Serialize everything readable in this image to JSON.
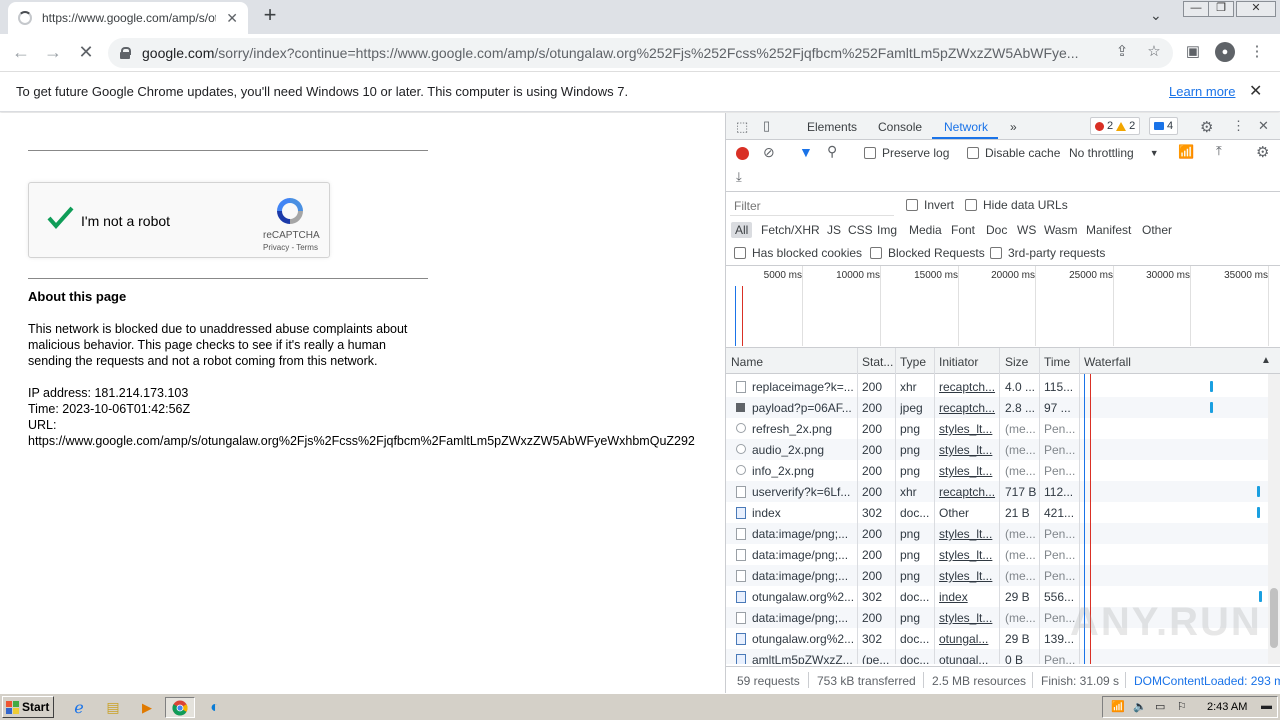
{
  "browser": {
    "tab_title": "https://www.google.com/amp/s/otungalaw.org",
    "tab_close": "✕",
    "new_tab": "+",
    "url_host": "google.com",
    "url_rest": "/sorry/index?continue=https://www.google.com/amp/s/otungalaw.org%252Fjs%252Fcss%252Fjqfbcm%252FamltLm5pZWxzZW5AbWFye...",
    "window_buttons": [
      "—",
      "❐",
      "✕"
    ]
  },
  "infobar": {
    "message": "To get future Google Chrome updates, you'll need Windows 10 or later. This computer is using Windows 7.",
    "learn_more": "Learn more",
    "close": "✕"
  },
  "page": {
    "captcha_label": "I'm not a robot",
    "captcha_brand": "reCAPTCHA",
    "captcha_links": "Privacy - Terms",
    "about_title": "About this page",
    "paragraph_lines": [
      "This network is blocked due to unaddressed abuse complaints about",
      "malicious behavior. This page checks to see if it's really a human",
      "sending the requests and not a robot coming from this network."
    ],
    "ip_line": "IP address: 181.214.173.103",
    "time_line": "Time: 2023-10-06T01:42:56Z",
    "url_label": "URL:",
    "url_value": "https://www.google.com/amp/s/otungalaw.org%2Fjs%2Fcss%2Fjqfbcm%2FamltLm5pZWxzZW5AbWFyeWxhbmQuZ292"
  },
  "devtools": {
    "tabs": [
      "Elements",
      "Console",
      "Network"
    ],
    "more_tabs": "»",
    "error_count": "2",
    "warning_count": "2",
    "message_count": "4",
    "preserve_log": "Preserve log",
    "disable_cache": "Disable cache",
    "throttling": "No throttling",
    "filter_placeholder": "Filter",
    "invert": "Invert",
    "hide_data_urls": "Hide data URLs",
    "filter_types": [
      "All",
      "Fetch/XHR",
      "JS",
      "CSS",
      "Img",
      "Media",
      "Font",
      "Doc",
      "WS",
      "Wasm",
      "Manifest",
      "Other"
    ],
    "has_blocked_cookies": "Has blocked cookies",
    "blocked_requests": "Blocked Requests",
    "third_party": "3rd-party requests",
    "overview_ticks": [
      "5000 ms",
      "10000 ms",
      "15000 ms",
      "20000 ms",
      "25000 ms",
      "30000 ms",
      "35000 ms"
    ],
    "columns": [
      "Name",
      "Stat...",
      "Type",
      "Initiator",
      "Size",
      "Time",
      "Waterfall"
    ],
    "rows": [
      {
        "name": "replaceimage?k=...",
        "status": "200",
        "type": "xhr",
        "initiator": "recaptch...",
        "size": "4.0 ...",
        "time": "115...",
        "icon": "blank",
        "wf": 1
      },
      {
        "name": "payload?p=06AF...",
        "status": "200",
        "type": "jpeg",
        "initiator": "recaptch...",
        "size": "2.8 ...",
        "time": "97 ...",
        "icon": "img",
        "wf": 1
      },
      {
        "name": "refresh_2x.png",
        "status": "200",
        "type": "png",
        "initiator": "styles_lt...",
        "size": "(me...",
        "time": "Pen...",
        "icon": "sym",
        "wf": 0
      },
      {
        "name": "audio_2x.png",
        "status": "200",
        "type": "png",
        "initiator": "styles_lt...",
        "size": "(me...",
        "time": "Pen...",
        "icon": "sym",
        "wf": 0
      },
      {
        "name": "info_2x.png",
        "status": "200",
        "type": "png",
        "initiator": "styles_lt...",
        "size": "(me...",
        "time": "Pen...",
        "icon": "sym",
        "wf": 0
      },
      {
        "name": "userverify?k=6Lf...",
        "status": "200",
        "type": "xhr",
        "initiator": "recaptch...",
        "size": "717 B",
        "time": "112...",
        "icon": "blank",
        "wf": 2
      },
      {
        "name": "index",
        "status": "302",
        "type": "doc...",
        "initiator": "Other",
        "size": "21 B",
        "time": "421...",
        "icon": "doc",
        "wf": 2
      },
      {
        "name": "data:image/png;...",
        "status": "200",
        "type": "png",
        "initiator": "styles_lt...",
        "size": "(me...",
        "time": "Pen...",
        "icon": "blank",
        "wf": 0
      },
      {
        "name": "data:image/png;...",
        "status": "200",
        "type": "png",
        "initiator": "styles_lt...",
        "size": "(me...",
        "time": "Pen...",
        "icon": "blank",
        "wf": 0
      },
      {
        "name": "data:image/png;...",
        "status": "200",
        "type": "png",
        "initiator": "styles_lt...",
        "size": "(me...",
        "time": "Pen...",
        "icon": "blank",
        "wf": 0
      },
      {
        "name": "otungalaw.org%2...",
        "status": "302",
        "type": "doc...",
        "initiator": "index",
        "size": "29 B",
        "time": "556...",
        "icon": "doc",
        "wf": 3
      },
      {
        "name": "data:image/png;...",
        "status": "200",
        "type": "png",
        "initiator": "styles_lt...",
        "size": "(me...",
        "time": "Pen...",
        "icon": "blank",
        "wf": 0
      },
      {
        "name": "otungalaw.org%2...",
        "status": "302",
        "type": "doc...",
        "initiator": "otungal...",
        "size": "29 B",
        "time": "139...",
        "icon": "doc",
        "wf": 0
      },
      {
        "name": "amltLm5pZWxzZ...",
        "status": "(pe...",
        "type": "doc...",
        "initiator": "otungal...",
        "size": "0 B",
        "time": "Pen...",
        "icon": "doc",
        "wf": 0
      }
    ],
    "status": {
      "requests": "59 requests",
      "transferred": "753 kB transferred",
      "resources": "2.5 MB resources",
      "finish": "Finish: 31.09 s",
      "dcl": "DOMContentLoaded: 293 ms"
    }
  },
  "taskbar": {
    "start": "Start",
    "clock": "2:43 AM"
  },
  "watermark": "ANY.RUN"
}
